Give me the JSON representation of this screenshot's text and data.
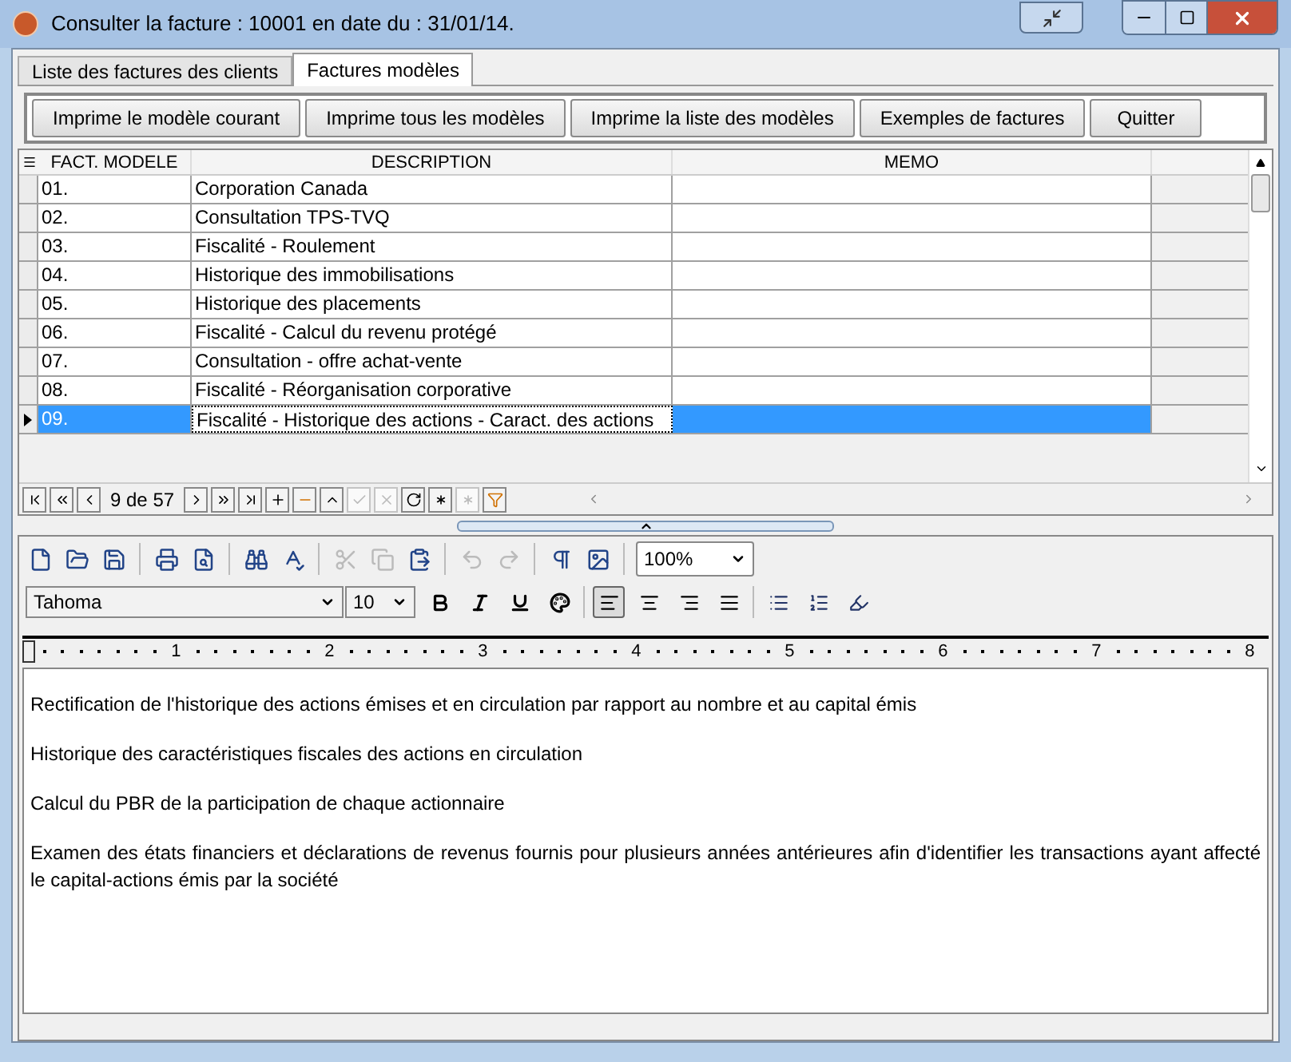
{
  "window": {
    "title": "Consulter la facture : 10001 en date du : 31/01/14."
  },
  "tabs": [
    {
      "label": "Liste des factures des clients",
      "selected": false
    },
    {
      "label": "Factures modèles",
      "selected": true
    }
  ],
  "buttons": [
    "Imprime le modèle courant",
    "Imprime tous les modèles",
    "Imprime la liste des modèles",
    "Exemples de factures",
    "Quitter"
  ],
  "table": {
    "columns": [
      "FACT. MODELE",
      "DESCRIPTION",
      "MEMO"
    ],
    "rows": [
      {
        "code": "01.",
        "description": "Corporation Canada",
        "selected": false
      },
      {
        "code": "02.",
        "description": "Consultation TPS-TVQ",
        "selected": false
      },
      {
        "code": "03.",
        "description": "Fiscalité - Roulement",
        "selected": false
      },
      {
        "code": "04.",
        "description": "Historique des immobilisations",
        "selected": false
      },
      {
        "code": "05.",
        "description": "Historique des placements",
        "selected": false
      },
      {
        "code": "06.",
        "description": "Fiscalité - Calcul du revenu protégé",
        "selected": false
      },
      {
        "code": "07.",
        "description": "Consultation - offre achat-vente",
        "selected": false
      },
      {
        "code": "08.",
        "description": "Fiscalité - Réorganisation corporative",
        "selected": false
      },
      {
        "code": "09.",
        "description": "Fiscalité - Historique des actions - Caract. des actions",
        "selected": true
      }
    ]
  },
  "navigator": {
    "position": "9 de 57",
    "buttons": [
      {
        "kind": "first",
        "disabled": false
      },
      {
        "kind": "prev-page",
        "disabled": false
      },
      {
        "kind": "prev",
        "disabled": false
      },
      {
        "kind": "next",
        "disabled": false
      },
      {
        "kind": "next-page",
        "disabled": false
      },
      {
        "kind": "last",
        "disabled": false
      },
      {
        "kind": "insert",
        "disabled": false
      },
      {
        "kind": "delete",
        "disabled": false
      },
      {
        "kind": "edit",
        "disabled": false
      },
      {
        "kind": "post",
        "disabled": true
      },
      {
        "kind": "cancel",
        "disabled": true
      },
      {
        "kind": "refresh",
        "disabled": false
      },
      {
        "kind": "apply",
        "disabled": false
      },
      {
        "kind": "cancel-updates",
        "disabled": true
      },
      {
        "kind": "filter",
        "disabled": false
      }
    ]
  },
  "toolbar": {
    "items": [
      {
        "kind": "new",
        "disabled": false
      },
      {
        "kind": "open",
        "disabled": false
      },
      {
        "kind": "save",
        "disabled": false
      },
      {
        "kind": "sep"
      },
      {
        "kind": "print",
        "disabled": false
      },
      {
        "kind": "preview",
        "disabled": false
      },
      {
        "kind": "sep"
      },
      {
        "kind": "find",
        "disabled": false
      },
      {
        "kind": "spell",
        "disabled": false
      },
      {
        "kind": "sep"
      },
      {
        "kind": "cut",
        "disabled": true
      },
      {
        "kind": "copy",
        "disabled": true
      },
      {
        "kind": "paste",
        "disabled": false
      },
      {
        "kind": "sep"
      },
      {
        "kind": "undo",
        "disabled": true
      },
      {
        "kind": "redo",
        "disabled": true
      },
      {
        "kind": "sep"
      },
      {
        "kind": "paragraph",
        "disabled": false
      },
      {
        "kind": "image",
        "disabled": false
      },
      {
        "kind": "sep"
      }
    ],
    "zoom": "100%"
  },
  "format_bar": {
    "font": "Tahoma",
    "size": "10",
    "styles": [
      {
        "kind": "bold",
        "selected": false
      },
      {
        "kind": "italic",
        "selected": false
      },
      {
        "kind": "underline",
        "selected": false
      },
      {
        "kind": "color",
        "selected": false
      }
    ],
    "alignment": [
      {
        "kind": "left",
        "selected": true
      },
      {
        "kind": "center",
        "selected": false
      },
      {
        "kind": "right",
        "selected": false
      },
      {
        "kind": "justify",
        "selected": false
      }
    ],
    "lists": [
      {
        "kind": "bullets"
      },
      {
        "kind": "numbers"
      },
      {
        "kind": "highlight"
      }
    ]
  },
  "ruler": [
    "1",
    "2",
    "3",
    "4",
    "5",
    "6",
    "7",
    "8"
  ],
  "editor": {
    "paragraphs": [
      "Rectification de l'historique des actions émises et en circulation par rapport au nombre et au capital émis",
      "Historique des caractéristiques fiscales des actions en circulation",
      "Calcul du PBR de la participation de chaque actionnaire",
      "Examen des états financiers et déclarations de revenus fournis pour plusieurs années antérieures afin d'identifier les transactions ayant affecté le capital-actions émis par la société"
    ]
  }
}
